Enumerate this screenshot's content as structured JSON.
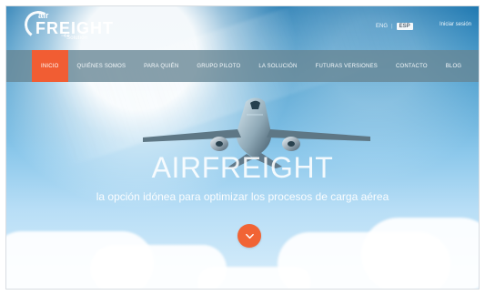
{
  "brand": {
    "logo_small": "air",
    "logo_main": "FREIGHT",
    "logo_sub": "Solution"
  },
  "header": {
    "language_eng": "ENG",
    "language_separator": "|",
    "language_esp": "ESP",
    "access": "Iniciar sesión"
  },
  "nav": {
    "items": [
      {
        "label": "INICIO"
      },
      {
        "label": "QUIÉNES SOMOS"
      },
      {
        "label": "PARA QUIÉN"
      },
      {
        "label": "GRUPO PILOTO"
      },
      {
        "label": "LA SOLUCIÓN"
      },
      {
        "label": "FUTURAS VERSIONES"
      },
      {
        "label": "CONTACTO"
      },
      {
        "label": "BLOG"
      }
    ]
  },
  "hero": {
    "title": "AIRFREIGHT",
    "subtitle": "la opción idónea para optimizar los procesos de carga aérea"
  },
  "icons": {
    "logo_icon": "swoosh-logo-icon",
    "plane_icon": "airplane-icon",
    "scroll_icon": "chevron-down-icon"
  },
  "colors": {
    "accent": "#f15d33",
    "navbar": "#678594"
  }
}
